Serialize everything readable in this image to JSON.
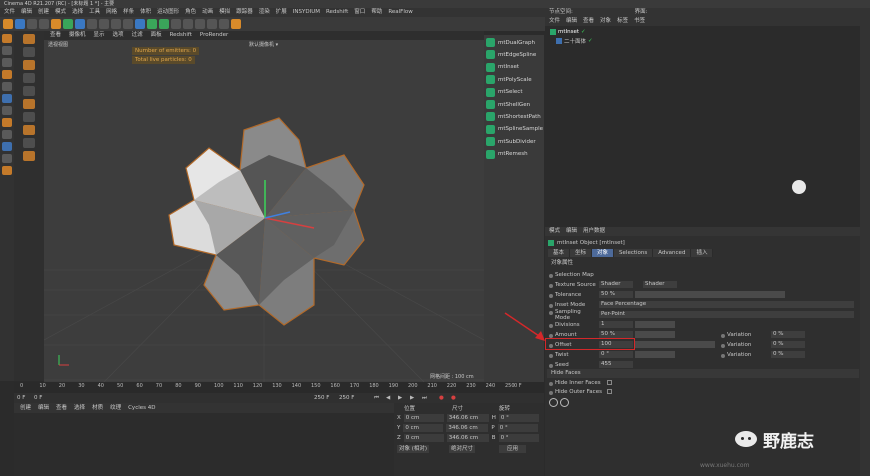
{
  "window": {
    "title": "Cinema 4D R21.207 (RC) - [未标题 1 *] - 主要"
  },
  "menu": [
    "文件",
    "编辑",
    "创建",
    "模式",
    "选择",
    "工具",
    "网格",
    "样条",
    "体积",
    "运动图形",
    "角色",
    "动画",
    "模拟",
    "跟踪器",
    "渲染",
    "扩展",
    "INSYDIUM",
    "Redshift",
    "窗口",
    "帮助",
    "RealFlow"
  ],
  "right_menu": {
    "label": "节点空间:",
    "layout": "界面:"
  },
  "viewport": {
    "menu": [
      "查看",
      "摄像机",
      "显示",
      "选项",
      "过滤",
      "面板",
      "Redshift",
      "ProRender"
    ],
    "label": "透视视图",
    "camera": "默认摄像机 ▾",
    "hud": [
      "Number of emitters: 0",
      "Total live particles: 0"
    ],
    "grid_info": "网格间距 : 100 cm"
  },
  "plugins": [
    "mtDualGraph",
    "mtEdgeSpline",
    "mtInset",
    "mtPolyScale",
    "mtSelect",
    "mtShellGen",
    "mtShortestPath",
    "mtSplineSample",
    "mtSubDivider",
    "mtRemesh"
  ],
  "timeline": {
    "ticks": [
      "0",
      "10",
      "20",
      "30",
      "40",
      "50",
      "60",
      "70",
      "80",
      "90",
      "100",
      "110",
      "120",
      "130",
      "140",
      "150",
      "160",
      "170",
      "180",
      "190",
      "200",
      "210",
      "220",
      "230",
      "240",
      "250"
    ],
    "frame": "0 F",
    "start": "0 F",
    "end": "250 F",
    "end2": "250 F",
    "current": "0 F"
  },
  "material_menu": [
    "创建",
    "编辑",
    "查看",
    "选择",
    "材质",
    "纹理",
    "Cycles 4D"
  ],
  "coords": {
    "headers": [
      "位置",
      "尺寸",
      "旋转"
    ],
    "rows": [
      {
        "axis": "X",
        "pos": "0 cm",
        "size": "346.06 cm",
        "rot_axis": "H",
        "rot": "0 °"
      },
      {
        "axis": "Y",
        "pos": "0 cm",
        "size": "346.06 cm",
        "rot_axis": "P",
        "rot": "0 °"
      },
      {
        "axis": "Z",
        "pos": "0 cm",
        "size": "346.06 cm",
        "rot_axis": "B",
        "rot": "0 °"
      }
    ],
    "mode": "对象 (相对)",
    "size_mode": "绝对尺寸",
    "apply": "应用"
  },
  "object_manager": {
    "menu": [
      "文件",
      "编辑",
      "查看",
      "对象",
      "标签",
      "书签"
    ],
    "items": [
      "mtInset",
      "二十面体"
    ]
  },
  "attributes": {
    "menu": [
      "模式",
      "编辑",
      "用户数据"
    ],
    "object_title": "mtInset Object [mtInset]",
    "tabs": [
      "基本",
      "坐标",
      "对象",
      "Selections",
      "Advanced",
      "插入"
    ],
    "section": "对象属性",
    "params": [
      {
        "label": "Selection Map",
        "value": ""
      },
      {
        "label": "Texture Source",
        "value": "Shader",
        "extra": "Shader"
      },
      {
        "label": "Tolerance",
        "value": "50 %"
      },
      {
        "label": "Inset Mode",
        "value": "Face Percentage"
      },
      {
        "label": "Sampling Mode",
        "value": "Per-Point"
      },
      {
        "label": "Divisions",
        "value": "1"
      },
      {
        "label": "Amount",
        "value": "50 %",
        "var_label": "Variation",
        "var": "0 %"
      },
      {
        "label": "Offset",
        "value": "100",
        "var_label": "Variation",
        "var": "0 %"
      },
      {
        "label": "Twist",
        "value": "0 °",
        "var_label": "Variation",
        "var": "0 %"
      },
      {
        "label": "Seed",
        "value": "455"
      }
    ],
    "hide_section": "Hide Faces",
    "hide_opts": [
      "Hide Inner Faces",
      "Hide Outer Faces"
    ]
  },
  "watermark": "野鹿志",
  "watermark_url": "www.xuehu.com"
}
